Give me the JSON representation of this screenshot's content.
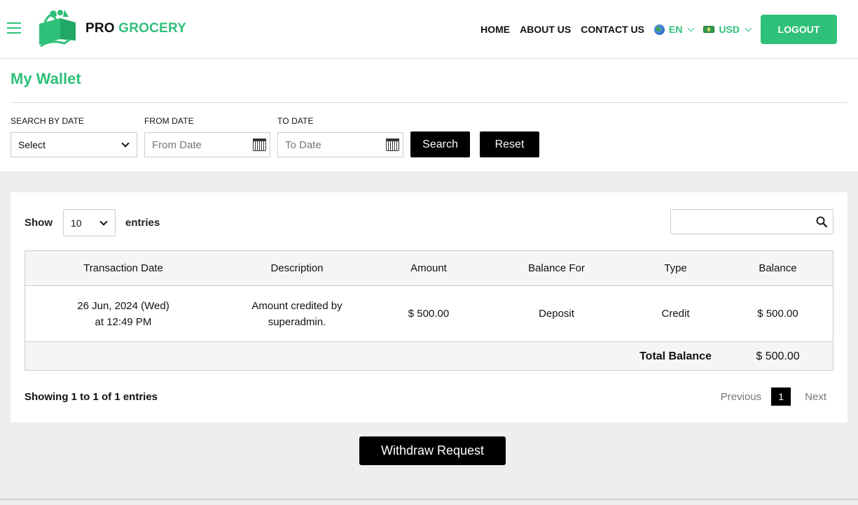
{
  "brand": {
    "pro": "PRO",
    "grocery": "GROCERY"
  },
  "nav": {
    "links": [
      "HOME",
      "ABOUT US",
      "CONTACT US"
    ],
    "language": "EN",
    "currency": "USD",
    "logout": "LOGOUT"
  },
  "page": {
    "title": "My Wallet"
  },
  "filters": {
    "search_by_date_label": "SEARCH BY DATE",
    "search_by_date_value": "Select",
    "from_date_label": "FROM DATE",
    "from_date_placeholder": "From Date",
    "to_date_label": "TO DATE",
    "to_date_placeholder": "To Date",
    "search_button": "Search",
    "reset_button": "Reset"
  },
  "table_controls": {
    "show": "Show",
    "entries_value": "10",
    "entries": "entries"
  },
  "table": {
    "headers": [
      "Transaction Date",
      "Description",
      "Amount",
      "Balance For",
      "Type",
      "Balance"
    ],
    "rows": [
      {
        "date_line1": "26 Jun, 2024 (Wed)",
        "date_line2": "at 12:49 PM",
        "desc_line1": "Amount credited by",
        "desc_line2": "superadmin.",
        "amount": "$ 500.00",
        "balance_for": "Deposit",
        "type": "Credit",
        "balance": "$ 500.00"
      }
    ],
    "footer": {
      "label": "Total Balance",
      "value": "$ 500.00"
    }
  },
  "pagination": {
    "info": "Showing 1 to 1 of 1 entries",
    "previous": "Previous",
    "current": "1",
    "next": "Next"
  },
  "withdraw_button": "Withdraw Request",
  "colors": {
    "brand_green": "#2fc07a",
    "button_black": "#000000",
    "page_grey": "#eeeeee"
  }
}
